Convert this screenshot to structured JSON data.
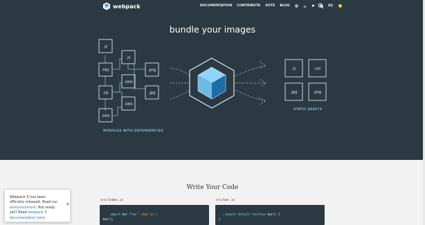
{
  "header": {
    "logo_text": "webpack",
    "nav": [
      {
        "label": "DOCUMENTATION"
      },
      {
        "label": "CONTRIBUTE"
      },
      {
        "label": "VOTE"
      },
      {
        "label": "BLOG"
      }
    ],
    "social_icons": [
      "github-icon",
      "stackoverflow-icon",
      "twitter-icon",
      "chat-icon"
    ],
    "lang_icon": "translate-icon",
    "theme_color": "#f5d020",
    "search_icon": "search-icon"
  },
  "hero": {
    "title": "bundle your images",
    "modules_caption": "MODULES WITH DEPENDENCIES",
    "assets_caption": "STATIC ASSETS",
    "modules": [
      {
        "label": ".js"
      },
      {
        "label": ".hbs"
      },
      {
        "label": ".js"
      },
      {
        "label": ".png"
      },
      {
        "label": ".sass"
      },
      {
        "label": ".cjs"
      },
      {
        "label": ".jpg"
      },
      {
        "label": ".sass"
      },
      {
        "label": ".sass"
      }
    ],
    "assets": [
      {
        "label": ".js"
      },
      {
        "label": ".css"
      },
      {
        "label": ".jpg"
      },
      {
        "label": ".png"
      }
    ]
  },
  "lower": {
    "title": "Write Your Code",
    "file1": "src/index.js",
    "file2": "src/bar.js",
    "code1": {
      "kw": "import",
      "id": "bar",
      "from": "from",
      "str": "'./bar.js'",
      "semi": ";",
      "call": "bar();"
    },
    "code2": {
      "line1a": "export default function",
      "line1b": "bar() {",
      "line2": "//",
      "line3": "}"
    }
  },
  "toast": {
    "line1": "Webpack 5 has been officially released. Read our",
    "link1": "announcement",
    "line2": ". Not ready yet? Read",
    "link2": "webpack 4 documentation here",
    "end": ".",
    "close": "×"
  },
  "colors": {
    "bg_dark": "#2b3a42",
    "accent": "#8dd6f9",
    "cube": "#1d78c1"
  }
}
